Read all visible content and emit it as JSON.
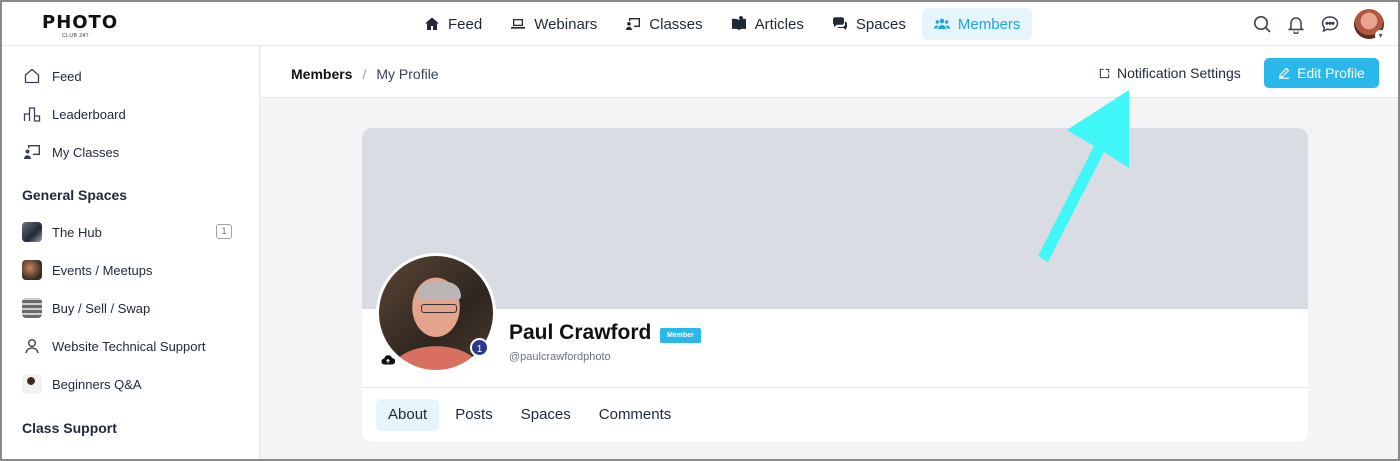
{
  "brand": {
    "logo_text": "PHOTO",
    "logo_sub": "CLUB 247"
  },
  "topnav": {
    "items": [
      {
        "label": "Feed",
        "icon": "home-icon"
      },
      {
        "label": "Webinars",
        "icon": "laptop-icon"
      },
      {
        "label": "Classes",
        "icon": "presentation-icon"
      },
      {
        "label": "Articles",
        "icon": "book-icon"
      },
      {
        "label": "Spaces",
        "icon": "chat-bubbles-icon"
      },
      {
        "label": "Members",
        "icon": "users-icon",
        "active": true
      }
    ],
    "accent": "#1ea5e0"
  },
  "sidebar": {
    "items": [
      {
        "label": "Feed",
        "icon": "home-icon"
      },
      {
        "label": "Leaderboard",
        "icon": "leaderboard-icon"
      },
      {
        "label": "My Classes",
        "icon": "presentation-icon"
      }
    ],
    "general_spaces": {
      "heading": "General Spaces",
      "items": [
        {
          "label": "The Hub",
          "count": "1"
        },
        {
          "label": "Events / Meetups"
        },
        {
          "label": "Buy / Sell / Swap"
        },
        {
          "label": "Website Technical Support",
          "icon": "person-icon"
        },
        {
          "label": "Beginners Q&A"
        }
      ]
    },
    "class_support": {
      "heading": "Class Support"
    }
  },
  "breadcrumb": {
    "section": "Members",
    "separator": "/",
    "current": "My Profile"
  },
  "actions": {
    "notification_settings": "Notification Settings",
    "edit_profile": "Edit Profile",
    "button_color": "#2ab7ea"
  },
  "profile": {
    "name": "Paul Crawford",
    "role_badge": "Member",
    "handle": "@paulcrawfordphoto",
    "level": "1",
    "cover_color": "#dadce4"
  },
  "tabs": [
    {
      "label": "About",
      "active": true
    },
    {
      "label": "Posts"
    },
    {
      "label": "Spaces"
    },
    {
      "label": "Comments"
    }
  ],
  "annotation": {
    "arrow_color": "#3ff7f7"
  }
}
